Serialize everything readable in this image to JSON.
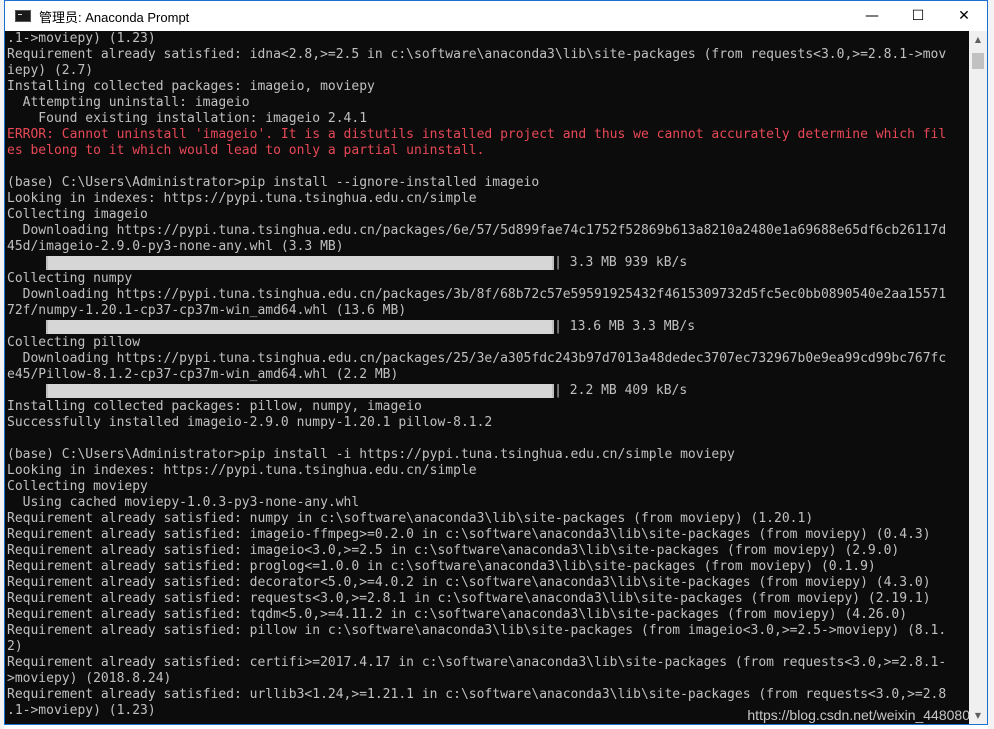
{
  "window": {
    "title": "管理员: Anaconda Prompt",
    "controls": {
      "minimize": "—",
      "maximize": "☐",
      "close": "✕"
    }
  },
  "console": {
    "lines": [
      ".1->moviepy) (1.23)",
      "Requirement already satisfied: idna<2.8,>=2.5 in c:\\software\\anaconda3\\lib\\site-packages (from requests<3.0,>=2.8.1->mov",
      "iepy) (2.7)",
      "Installing collected packages: imageio, moviepy",
      "  Attempting uninstall: imageio",
      "    Found existing installation: imageio 2.4.1",
      "ERROR: Cannot uninstall 'imageio'. It is a distutils installed project and thus we cannot accurately determine which fil",
      "es belong to it which would lead to only a partial uninstall.",
      "",
      "(base) C:\\Users\\Administrator>pip install --ignore-installed imageio",
      "Looking in indexes: https://pypi.tuna.tsinghua.edu.cn/simple",
      "Collecting imageio",
      "  Downloading https://pypi.tuna.tsinghua.edu.cn/packages/6e/57/5d899fae74c1752f52869b613a8210a2480e1a69688e65df6cb26117d",
      "45d/imageio-2.9.0-py3-none-any.whl (3.3 MB)",
      "PROGRESS:| 3.3 MB 939 kB/s",
      "Collecting numpy",
      "  Downloading https://pypi.tuna.tsinghua.edu.cn/packages/3b/8f/68b72c57e59591925432f4615309732d5fc5ec0bb0890540e2aa15571",
      "72f/numpy-1.20.1-cp37-cp37m-win_amd64.whl (13.6 MB)",
      "PROGRESS:| 13.6 MB 3.3 MB/s",
      "Collecting pillow",
      "  Downloading https://pypi.tuna.tsinghua.edu.cn/packages/25/3e/a305fdc243b97d7013a48dedec3707ec732967b0e9ea99cd99bc767fc",
      "e45/Pillow-8.1.2-cp37-cp37m-win_amd64.whl (2.2 MB)",
      "PROGRESS:| 2.2 MB 409 kB/s",
      "Installing collected packages: pillow, numpy, imageio",
      "Successfully installed imageio-2.9.0 numpy-1.20.1 pillow-8.1.2",
      "",
      "(base) C:\\Users\\Administrator>pip install -i https://pypi.tuna.tsinghua.edu.cn/simple moviepy",
      "Looking in indexes: https://pypi.tuna.tsinghua.edu.cn/simple",
      "Collecting moviepy",
      "  Using cached moviepy-1.0.3-py3-none-any.whl",
      "Requirement already satisfied: numpy in c:\\software\\anaconda3\\lib\\site-packages (from moviepy) (1.20.1)",
      "Requirement already satisfied: imageio-ffmpeg>=0.2.0 in c:\\software\\anaconda3\\lib\\site-packages (from moviepy) (0.4.3)",
      "Requirement already satisfied: imageio<3.0,>=2.5 in c:\\software\\anaconda3\\lib\\site-packages (from moviepy) (2.9.0)",
      "Requirement already satisfied: proglog<=1.0.0 in c:\\software\\anaconda3\\lib\\site-packages (from moviepy) (0.1.9)",
      "Requirement already satisfied: decorator<5.0,>=4.0.2 in c:\\software\\anaconda3\\lib\\site-packages (from moviepy) (4.3.0)",
      "Requirement already satisfied: requests<3.0,>=2.8.1 in c:\\software\\anaconda3\\lib\\site-packages (from moviepy) (2.19.1)",
      "Requirement already satisfied: tqdm<5.0,>=4.11.2 in c:\\software\\anaconda3\\lib\\site-packages (from moviepy) (4.26.0)",
      "Requirement already satisfied: pillow in c:\\software\\anaconda3\\lib\\site-packages (from imageio<3.0,>=2.5->moviepy) (8.1.",
      "2)",
      "Requirement already satisfied: certifi>=2017.4.17 in c:\\software\\anaconda3\\lib\\site-packages (from requests<3.0,>=2.8.1-",
      ">moviepy) (2018.8.24)",
      "Requirement already satisfied: urllib3<1.24,>=1.21.1 in c:\\software\\anaconda3\\lib\\site-packages (from requests<3.0,>=2.8",
      ".1->moviepy) (1.23)"
    ],
    "error_line_indices": [
      6,
      7
    ],
    "colors": {
      "background": "#0c0c0c",
      "text": "#c0c0c0",
      "error": "#e74856"
    }
  },
  "watermark": "https://blog.csdn.net/weixin_448080"
}
